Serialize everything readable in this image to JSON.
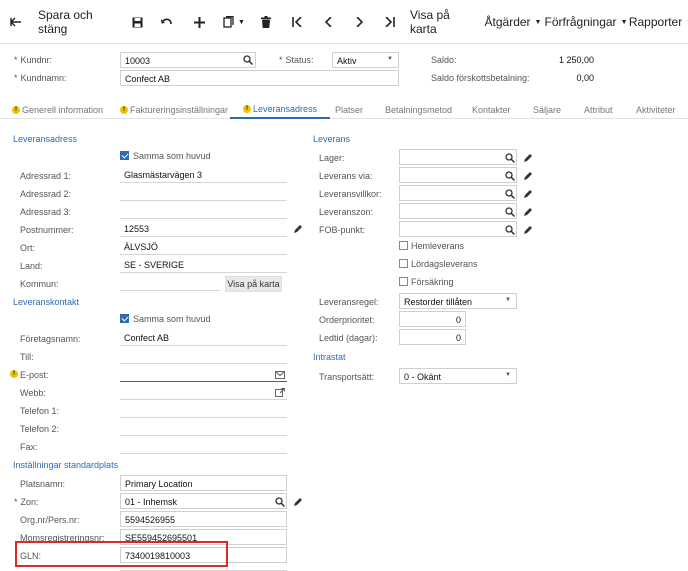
{
  "toolbar": {
    "back_icon": "arrow-left-icon",
    "save_close": "Spara och stäng",
    "show_map": "Visa på karta",
    "actions": "Åtgärder",
    "inquiries": "Förfrågningar",
    "reports": "Rapporter"
  },
  "header": {
    "customer_no_label": "Kundnr:",
    "customer_no": "10003",
    "customer_name_label": "Kundnamn:",
    "customer_name": "Confect AB",
    "status_label": "Status:",
    "status": "Aktiv",
    "balance_label": "Saldo:",
    "balance": "1 250,00",
    "prepay_label": "Saldo förskottsbetalning:",
    "prepay": "0,00"
  },
  "tabs": [
    {
      "label": "Generell information",
      "warn": true
    },
    {
      "label": "Faktureringsinställningar",
      "warn": true
    },
    {
      "label": "Leveransadress",
      "warn": true,
      "active": true
    },
    {
      "label": "Platser"
    },
    {
      "label": "Betalningsmetod"
    },
    {
      "label": "Kontakter"
    },
    {
      "label": "Säljare"
    },
    {
      "label": "Attribut"
    },
    {
      "label": "Aktiviteter"
    }
  ],
  "address": {
    "section": "Leveransadress",
    "same_as_main": "Samma som huvud",
    "addr1_label": "Adressrad 1:",
    "addr1": "Glasmästarvägen 3",
    "addr2_label": "Adressrad 2:",
    "addr3_label": "Adressrad 3:",
    "postal_label": "Postnummer:",
    "postal": "12553",
    "city_label": "Ort:",
    "city": "ÄLVSJÖ",
    "country_label": "Land:",
    "country": "SE - SVERIGE",
    "county_label": "Kommun:",
    "show_map": "Visa på karta"
  },
  "contact": {
    "section": "Leveranskontakt",
    "same_as_main": "Samma som huvud",
    "company_label": "Företagsnamn:",
    "company": "Confect AB",
    "to_label": "Till:",
    "email_label": "E-post:",
    "web_label": "Webb:",
    "phone1_label": "Telefon 1:",
    "phone2_label": "Telefon 2:",
    "fax_label": "Fax:"
  },
  "location": {
    "section": "Inställningar standardplats",
    "name_label": "Platsnamn:",
    "name": "Primary Location",
    "zone_label": "Zon:",
    "zone": "01 - Inhemsk",
    "org_label": "Org.nr/Pers.nr:",
    "org": "5594526955",
    "vat_label": "Momsregistreringsnr:",
    "vat": "SE559452695501",
    "gln_label": "GLN:",
    "gln": "7340019810003"
  },
  "delivery": {
    "section": "Leverans",
    "warehouse_label": "Lager:",
    "via_label": "Leverans via:",
    "terms_label": "Leveransvillkor:",
    "zone_label": "Leveranszon:",
    "fob_label": "FOB-punkt:",
    "home_delivery": "Hemleverans",
    "saturday_delivery": "Lördagsleverans",
    "insurance": "Försäkring",
    "rule_label": "Leveransregel:",
    "rule": "Restorder tillåten",
    "priority_label": "Orderprioritet:",
    "priority": "0",
    "leadtime_label": "Ledtid (dagar):",
    "leadtime": "0"
  },
  "intrastat": {
    "section": "Intrastat",
    "transport_label": "Transportsätt:",
    "transport": "0 - Okänt"
  }
}
